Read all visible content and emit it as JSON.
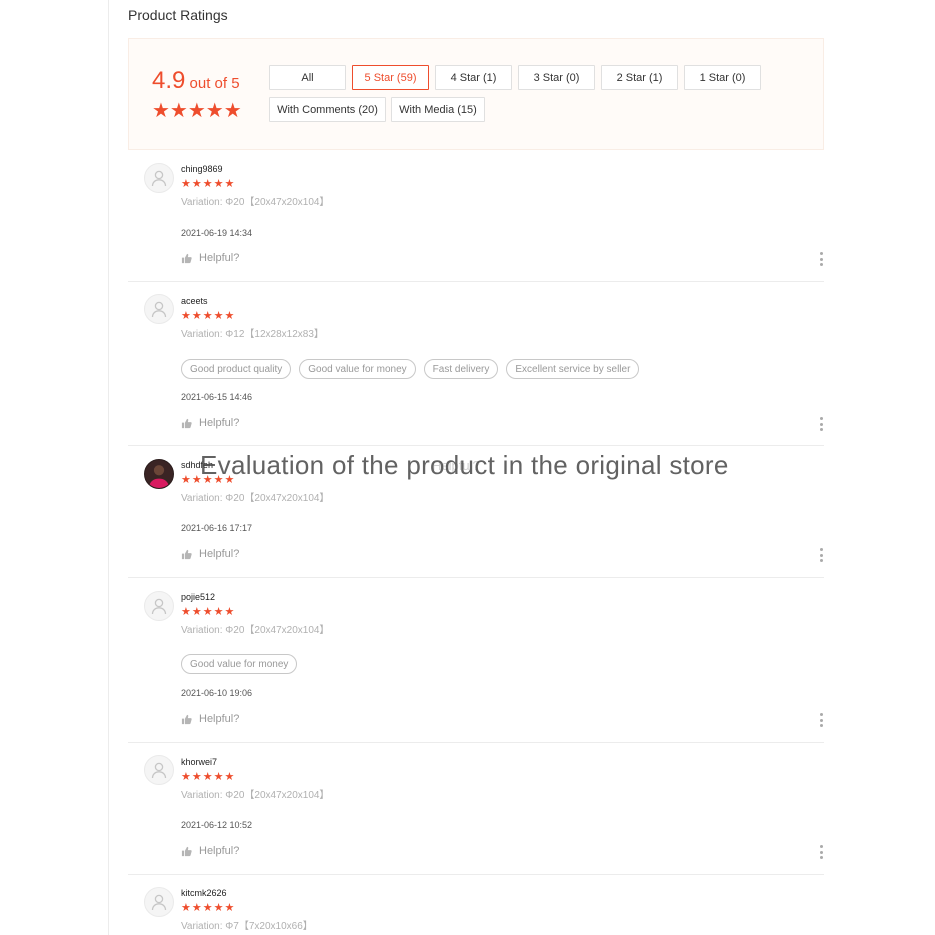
{
  "section": {
    "title": "Product Ratings"
  },
  "overview": {
    "score": "4.9",
    "out_of": " out of 5",
    "rating_stars": 5,
    "stars_text": "★★★★★"
  },
  "filters": [
    {
      "label": "All",
      "active": false
    },
    {
      "label": "5 Star (59)",
      "active": true
    },
    {
      "label": "4 Star (1)",
      "active": false
    },
    {
      "label": "3 Star (0)",
      "active": false
    },
    {
      "label": "2 Star (1)",
      "active": false
    },
    {
      "label": "1 Star (0)",
      "active": false
    },
    {
      "label": "With Comments (20)",
      "active": false
    },
    {
      "label": "With Media (15)",
      "active": false
    }
  ],
  "reviews": [
    {
      "username": "ching9869",
      "stars": "★★★★★",
      "rating": 5,
      "variation": "Variation: Φ20【20x47x20x104】",
      "tags": [],
      "datetime": "2021-06-19 14:34",
      "helpful": "Helpful?"
    },
    {
      "username": "aceets",
      "stars": "★★★★★",
      "rating": 5,
      "variation": "Variation: Φ12【12x28x12x83】",
      "tags": [
        "Good product quality",
        "Good value for money",
        "Fast delivery",
        "Excellent service by seller"
      ],
      "datetime": "2021-06-15 14:46",
      "helpful": "Helpful?"
    },
    {
      "username": "sdhdfeh",
      "stars": "★★★★★",
      "rating": 5,
      "variation": "Variation: Φ20【20x47x20x104】",
      "tags": [],
      "datetime": "2021-06-16 17:17",
      "helpful": "Helpful?"
    },
    {
      "username": "pojie512",
      "stars": "★★★★★",
      "rating": 5,
      "variation": "Variation: Φ20【20x47x20x104】",
      "tags": [
        "Good value for money"
      ],
      "datetime": "2021-06-10 19:06",
      "helpful": "Helpful?"
    },
    {
      "username": "khorwei7",
      "stars": "★★★★★",
      "rating": 5,
      "variation": "Variation: Φ20【20x47x20x104】",
      "tags": [],
      "datetime": "2021-06-12 10:52",
      "helpful": "Helpful?"
    },
    {
      "username": "kitcmk2626",
      "stars": "★★★★★",
      "rating": 5,
      "variation": "Variation: Φ7【7x20x10x66】",
      "tags": [],
      "datetime": "",
      "helpful": ""
    }
  ],
  "watermark": {
    "text": "Evaluation of the product in the original store",
    "ghost": "Helpful?"
  },
  "colors": {
    "accent": "#ee4d2d",
    "overview_bg": "#fffbf8"
  }
}
